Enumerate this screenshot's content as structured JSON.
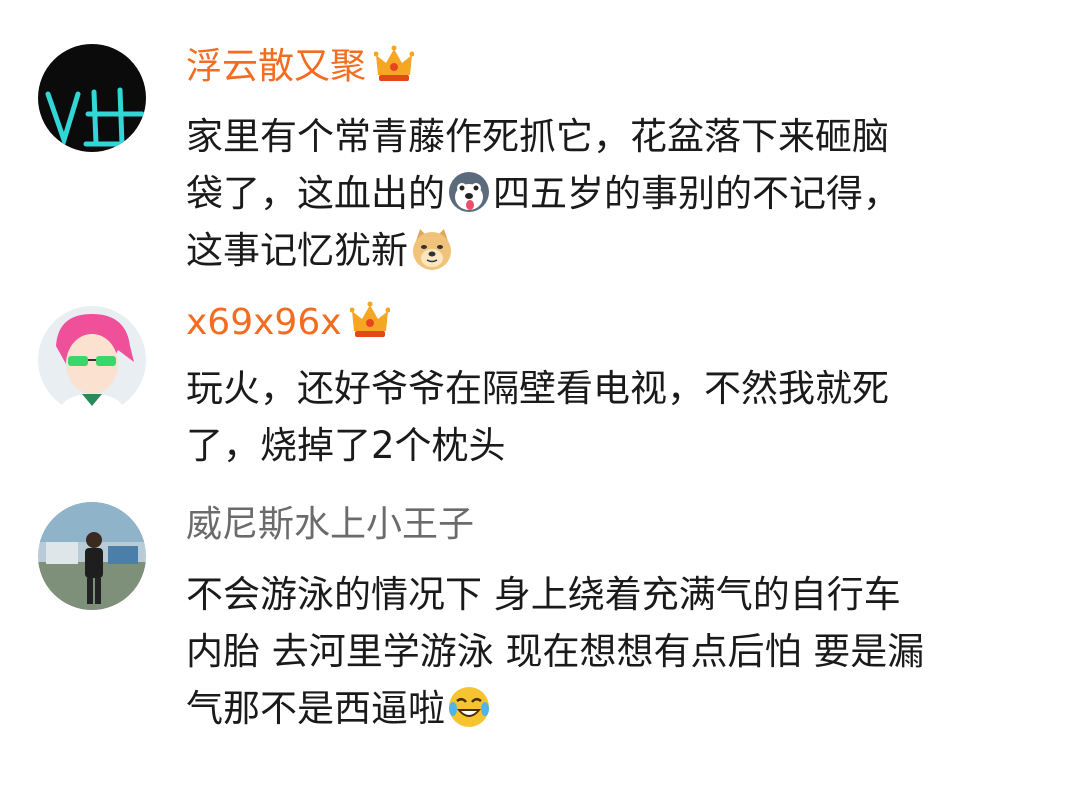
{
  "comments": [
    {
      "username": "浮云散又聚",
      "vip": true,
      "lines": [
        {
          "before": "家里有个常青藤作死抓它，花盆落下来砸脑",
          "after": ""
        },
        {
          "before": "袋了，这血出的",
          "after": "四五岁的事别的不记得，"
        },
        {
          "before": "这事记忆犹新",
          "after": ""
        }
      ],
      "emojis": [
        "husky-face-emoji",
        "doge-face-emoji"
      ]
    },
    {
      "username": "x69x96x",
      "vip": true,
      "lines": [
        {
          "before": "玩火，还好爷爷在隔壁看电视，不然我就死",
          "after": ""
        },
        {
          "before": "了，烧掉了2个枕头",
          "after": ""
        }
      ]
    },
    {
      "username": "威尼斯水上小王子",
      "vip": false,
      "lines": [
        {
          "before": "不会游泳的情况下 身上绕着充满气的自行车",
          "after": ""
        },
        {
          "before": "内胎 去河里学游泳 现在想想有点后怕 要是漏",
          "after": ""
        },
        {
          "before": "气那不是西逼啦",
          "after": ""
        }
      ],
      "emojis": [
        "laughing-tears-emoji"
      ]
    }
  ],
  "colors": {
    "vip_name": "#f36c21",
    "plain_name": "#6b6b6b",
    "body_text": "#1a1a1a",
    "crown": "#f5a623"
  }
}
